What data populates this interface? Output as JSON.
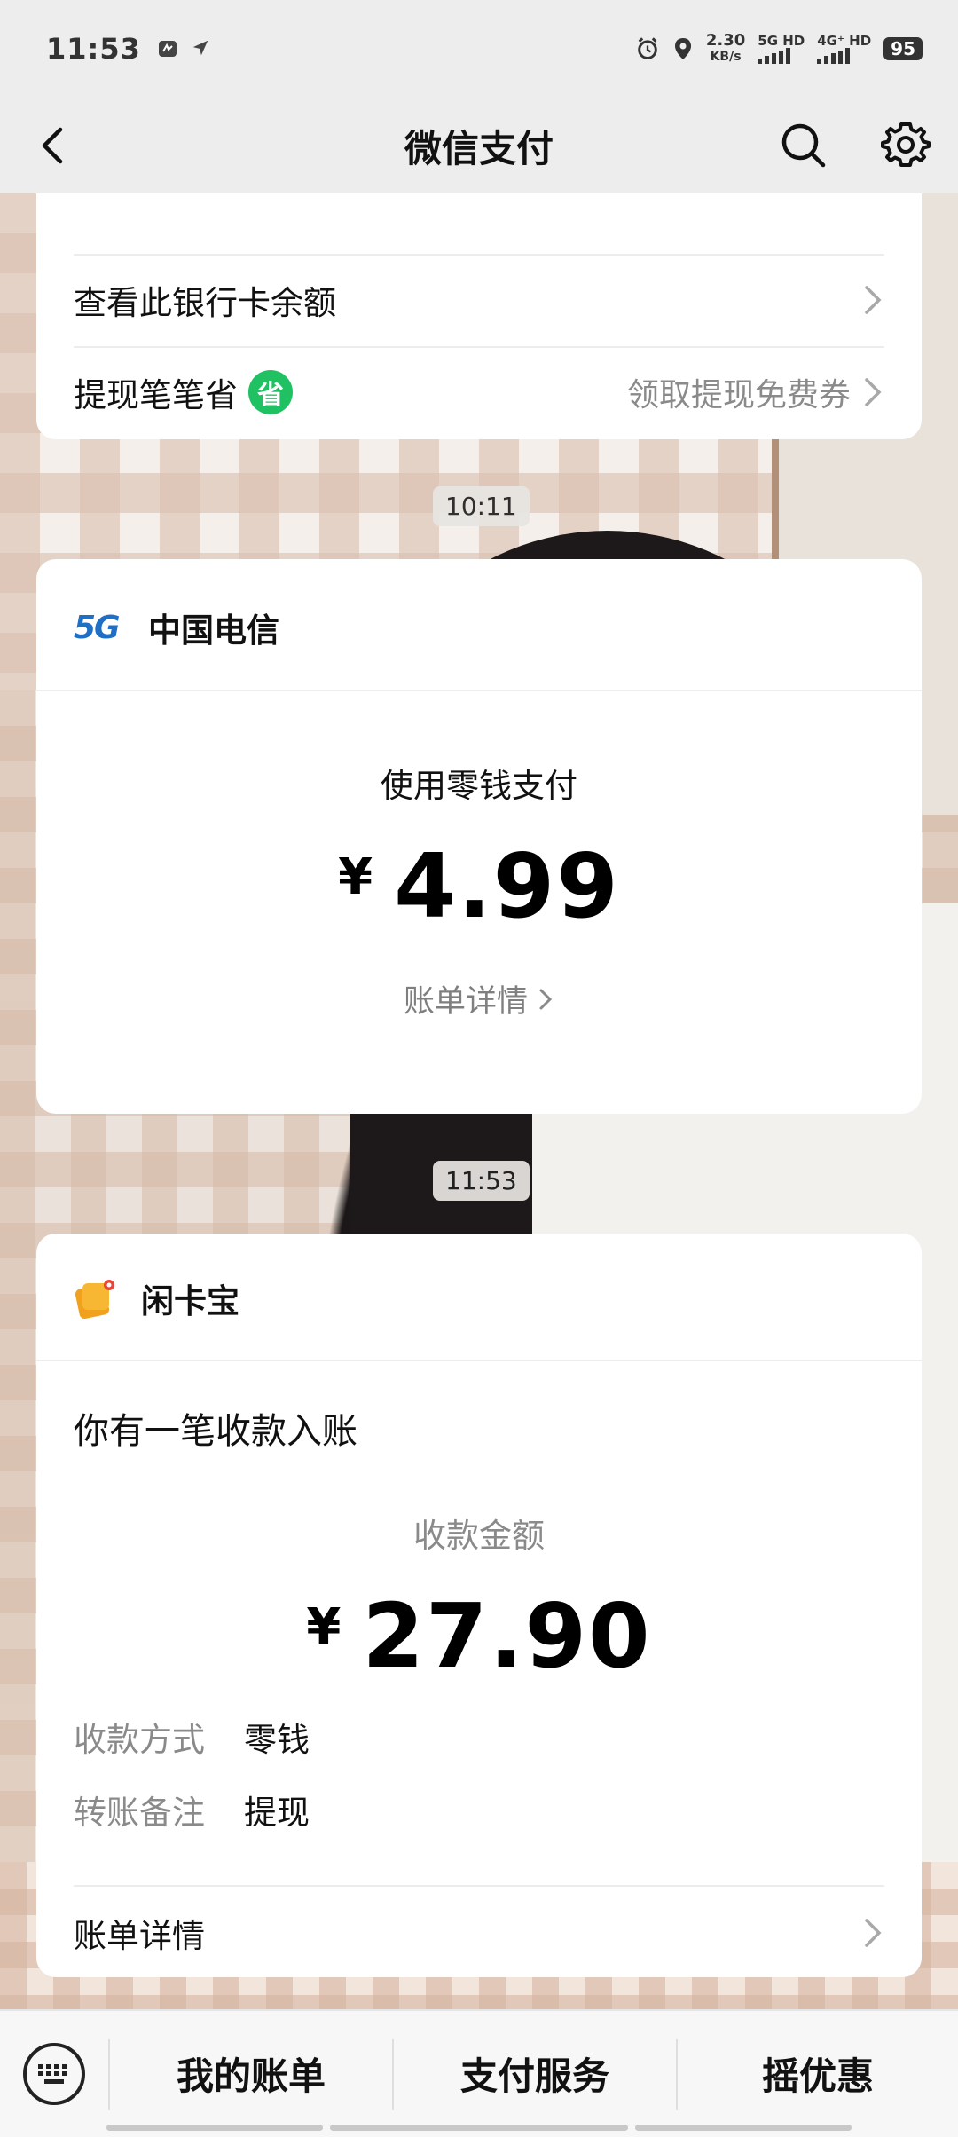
{
  "status_bar": {
    "time": "11:53",
    "net_speed_value": "2.30",
    "net_speed_unit": "KB/s",
    "network1": "5G HD",
    "network2": "4G⁺ HD",
    "battery": "95"
  },
  "nav": {
    "title": "微信支付"
  },
  "top_card": {
    "row1_label": "查看此银行卡余额",
    "row2_label": "提现笔笔省",
    "row2_badge": "省",
    "row2_right": "领取提现免费券"
  },
  "timestamps": {
    "first": "10:11",
    "second": "11:53"
  },
  "telecom_card": {
    "merchant": "中国电信",
    "logo_text": "5G",
    "pay_method_label": "使用零钱支付",
    "currency": "¥",
    "amount": "4.99",
    "detail_link": "账单详情"
  },
  "xkb_card": {
    "merchant": "闲卡宝",
    "headline": "你有一笔收款入账",
    "amount_label": "收款金额",
    "currency": "¥",
    "amount": "27.90",
    "fields": [
      {
        "key": "收款方式",
        "value": "零钱"
      },
      {
        "key": "转账备注",
        "value": "提现"
      }
    ],
    "detail_row": "账单详情"
  },
  "bottom_bar": {
    "items": [
      "我的账单",
      "支付服务",
      "摇优惠"
    ]
  },
  "colors": {
    "accent_green": "#20c163",
    "bg_header": "#ededed"
  }
}
